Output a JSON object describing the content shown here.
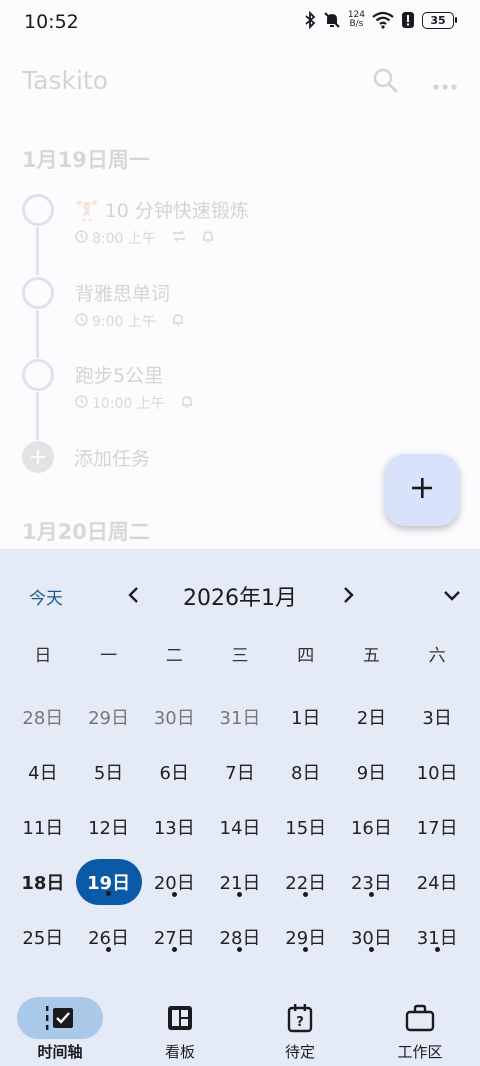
{
  "status_bar": {
    "time": "10:52",
    "net_speed_value": "124",
    "net_speed_unit": "B/s",
    "battery": "35",
    "icons": [
      "bluetooth-icon",
      "mute-icon",
      "wifi-icon",
      "alert-icon",
      "battery-icon"
    ]
  },
  "app": {
    "title": "Taskito",
    "actions": [
      "search-icon",
      "more-icon"
    ]
  },
  "timeline": {
    "date1": "1月19日周一",
    "tasks": [
      {
        "title": "🏋 10 分钟快速锻炼",
        "time": "8:00 上午",
        "repeat": true,
        "reminder": true
      },
      {
        "title": "背雅思单词",
        "time": "9:00 上午",
        "repeat": false,
        "reminder": true
      },
      {
        "title": "跑步5公里",
        "time": "10:00 上午",
        "repeat": false,
        "reminder": true
      }
    ],
    "add_task_label": "添加任务",
    "date2": "1月20日周二"
  },
  "fab": {
    "icon": "plus-icon"
  },
  "calendar": {
    "today_label": "今天",
    "month_label": "2026年1月",
    "weekdays": [
      "日",
      "一",
      "二",
      "三",
      "四",
      "五",
      "六"
    ],
    "days": [
      {
        "label": "28日",
        "muted": true
      },
      {
        "label": "29日",
        "muted": true
      },
      {
        "label": "30日",
        "muted": true
      },
      {
        "label": "31日",
        "muted": true
      },
      {
        "label": "1日"
      },
      {
        "label": "2日"
      },
      {
        "label": "3日"
      },
      {
        "label": "4日"
      },
      {
        "label": "5日"
      },
      {
        "label": "6日"
      },
      {
        "label": "7日"
      },
      {
        "label": "8日"
      },
      {
        "label": "9日"
      },
      {
        "label": "10日"
      },
      {
        "label": "11日"
      },
      {
        "label": "12日"
      },
      {
        "label": "13日"
      },
      {
        "label": "14日"
      },
      {
        "label": "15日"
      },
      {
        "label": "16日"
      },
      {
        "label": "17日"
      },
      {
        "label": "18日",
        "today": true
      },
      {
        "label": "19日",
        "selected": true,
        "dot": true
      },
      {
        "label": "20日",
        "dot": true
      },
      {
        "label": "21日",
        "dot": true
      },
      {
        "label": "22日",
        "dot": true
      },
      {
        "label": "23日",
        "dot": true
      },
      {
        "label": "24日"
      },
      {
        "label": "25日"
      },
      {
        "label": "26日",
        "dot": true
      },
      {
        "label": "27日",
        "dot": true
      },
      {
        "label": "28日",
        "dot": true
      },
      {
        "label": "29日",
        "dot": true
      },
      {
        "label": "30日",
        "dot": true
      },
      {
        "label": "31日",
        "dot": true
      }
    ]
  },
  "bottom_nav": [
    {
      "label": "时间轴",
      "icon": "timeline-icon",
      "active": true
    },
    {
      "label": "看板",
      "icon": "board-icon"
    },
    {
      "label": "待定",
      "icon": "pending-icon"
    },
    {
      "label": "工作区",
      "icon": "workspace-icon"
    }
  ],
  "colors": {
    "accent": "#0b5aa8",
    "sheet_bg": "#e5ebf6",
    "active_nav_bg": "#aac8e8",
    "fab_bg": "#d8e2fb"
  }
}
